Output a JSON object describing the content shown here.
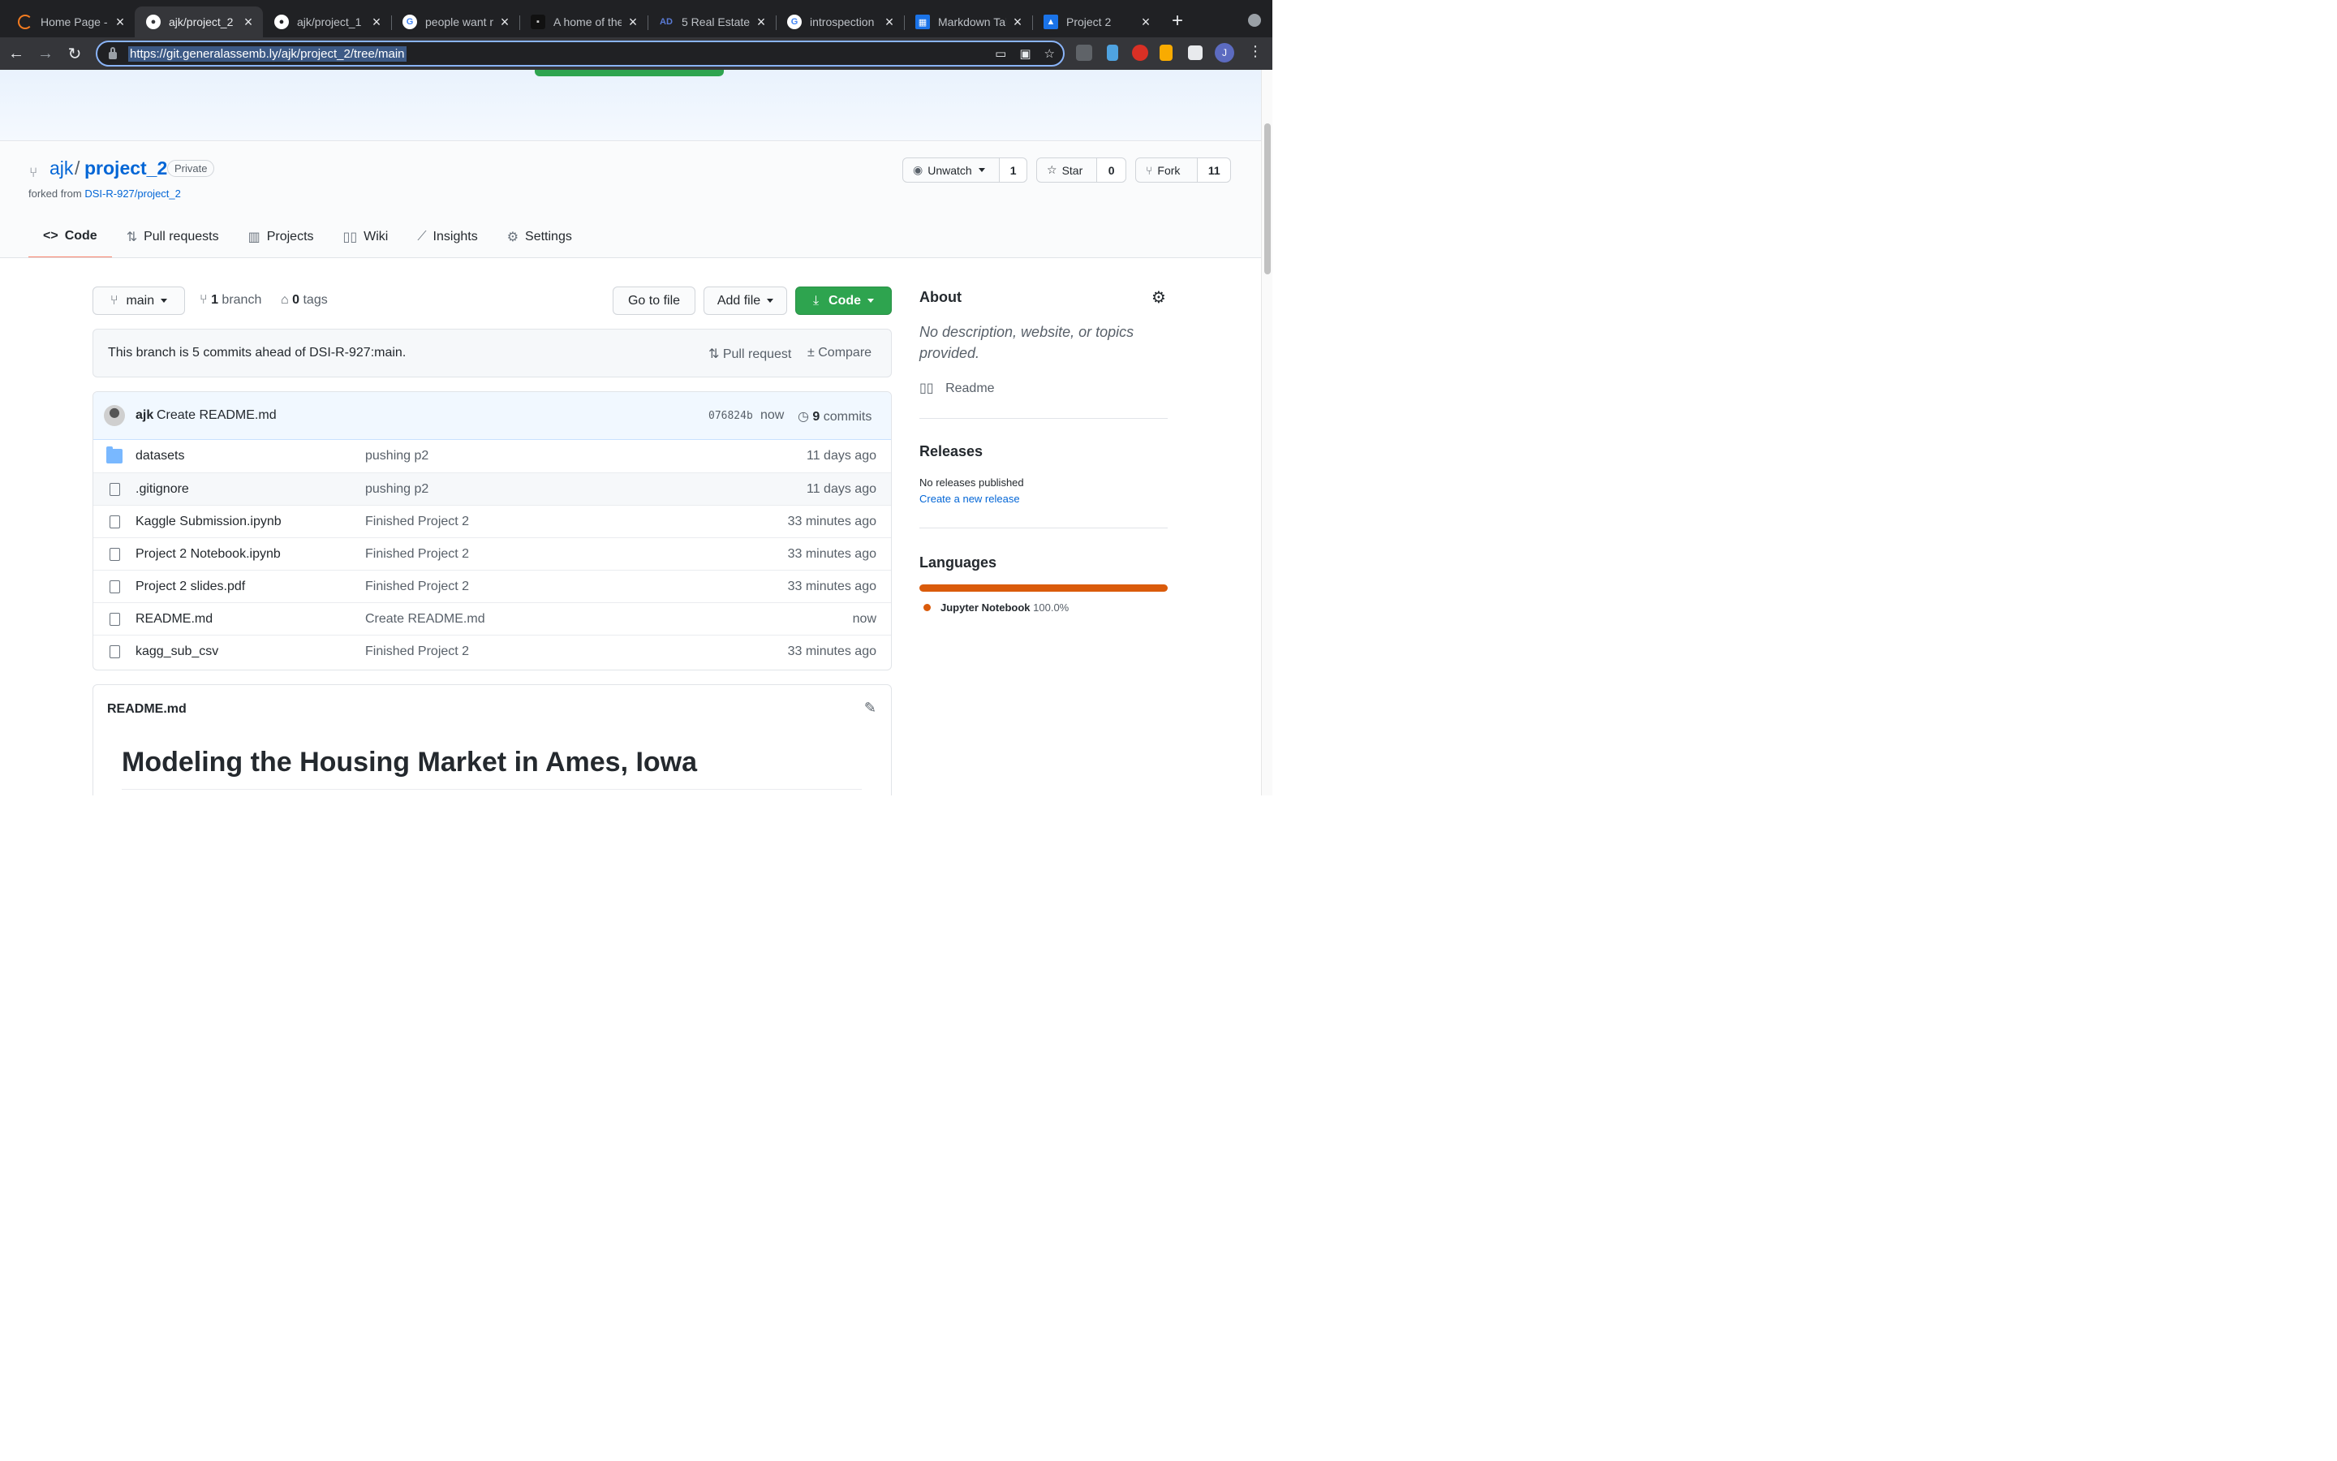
{
  "browser": {
    "tabs": [
      {
        "title": "Home Page - S",
        "icon": "loader-icon",
        "color": "#f47c20"
      },
      {
        "title": "ajk/project_2",
        "icon": "github-icon",
        "color": "#ffffff"
      },
      {
        "title": "ajk/project_1",
        "icon": "github-icon",
        "color": "#ffffff"
      },
      {
        "title": "people want m",
        "icon": "google-icon",
        "color": "#ffffff"
      },
      {
        "title": "A home of the",
        "icon": "site-icon",
        "color": "#333333"
      },
      {
        "title": "5 Real Estate",
        "icon": "ad-icon",
        "color": "#1e3a8a"
      },
      {
        "title": "introspection",
        "icon": "google-icon",
        "color": "#ffffff"
      },
      {
        "title": "Markdown Tab",
        "icon": "table-icon",
        "color": "#1a73e8"
      },
      {
        "title": "Project 2",
        "icon": "contact-icon",
        "color": "#1a73e8"
      }
    ],
    "url": "https://git.generalassemb.ly/ajk/project_2/tree/main",
    "profile_initial": "J"
  },
  "repo": {
    "owner": "ajk",
    "separator": "/",
    "name": "project_2",
    "visibility": "Private",
    "forked_prefix": "forked from",
    "forked_from": "DSI-R-927/project_2",
    "watch_label": "Unwatch",
    "watch_count": "1",
    "star_label": "Star",
    "star_count": "0",
    "fork_label": "Fork",
    "fork_count": "11"
  },
  "nav": {
    "code": "Code",
    "pulls": "Pull requests",
    "projects": "Projects",
    "wiki": "Wiki",
    "insights": "Insights",
    "settings": "Settings"
  },
  "toolbar": {
    "branch": "main",
    "branch_count": "1",
    "branch_label": "branch",
    "tag_count": "0",
    "tag_label": "tags",
    "go_to_file": "Go to file",
    "add_file": "Add file",
    "code": "Code"
  },
  "ahead": {
    "message": "This branch is 5 commits ahead of DSI-R-927:main.",
    "pull_request": "Pull request",
    "compare": "Compare"
  },
  "commit": {
    "author": "ajk",
    "message": "Create README.md",
    "sha": "076824b",
    "when": "now",
    "count": "9",
    "count_label": "commits"
  },
  "files": [
    {
      "name": "datasets",
      "message": "pushing p2",
      "age": "11 days ago",
      "type": "folder"
    },
    {
      "name": ".gitignore",
      "message": "pushing p2",
      "age": "11 days ago",
      "type": "file"
    },
    {
      "name": "Kaggle Submission.ipynb",
      "message": "Finished Project 2",
      "age": "33 minutes ago",
      "type": "file"
    },
    {
      "name": "Project 2 Notebook.ipynb",
      "message": "Finished Project 2",
      "age": "33 minutes ago",
      "type": "file"
    },
    {
      "name": "Project 2 slides.pdf",
      "message": "Finished Project 2",
      "age": "33 minutes ago",
      "type": "file"
    },
    {
      "name": "README.md",
      "message": "Create README.md",
      "age": "now",
      "type": "file"
    },
    {
      "name": "kagg_sub_csv",
      "message": "Finished Project 2",
      "age": "33 minutes ago",
      "type": "file"
    }
  ],
  "readme": {
    "filename": "README.md",
    "heading": "Modeling the Housing Market in Ames, Iowa"
  },
  "about": {
    "title": "About",
    "description": "No description, website, or topics provided.",
    "readme_link": "Readme"
  },
  "releases": {
    "title": "Releases",
    "none": "No releases published",
    "create": "Create a new release"
  },
  "languages": {
    "title": "Languages",
    "items": [
      {
        "name": "Jupyter Notebook",
        "percent": "100.0%",
        "color": "#da5b0b"
      }
    ]
  }
}
